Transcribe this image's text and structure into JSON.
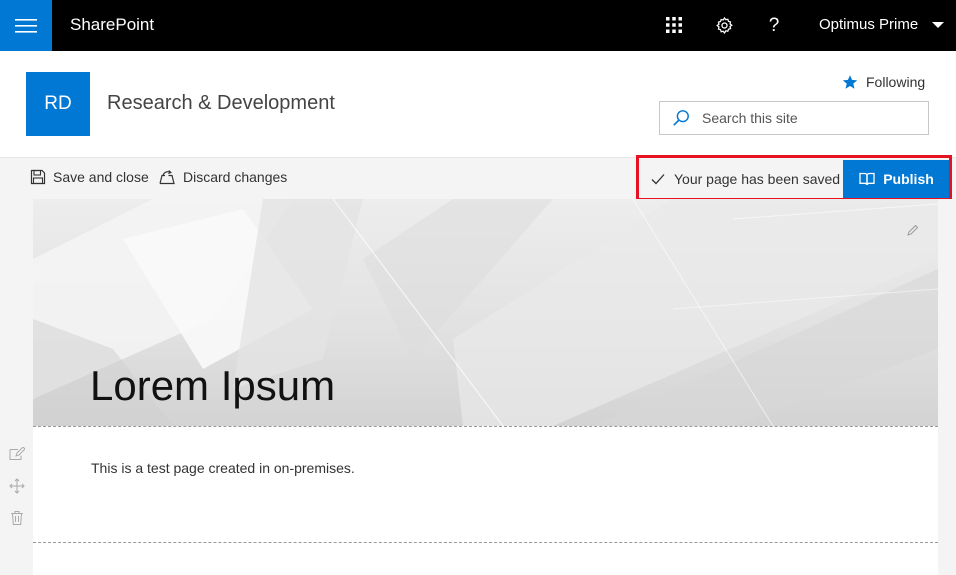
{
  "suitebar": {
    "brand": "SharePoint",
    "user_name": "Optimus Prime",
    "help_glyph": "?",
    "icons": {
      "menu": "hamburger-icon",
      "app_launcher": "app-launcher-icon",
      "settings": "gear-icon",
      "help": "help-icon",
      "user_menu": "chevron-down-icon"
    }
  },
  "site": {
    "logo_initials": "RD",
    "title": "Research & Development",
    "following_label": "Following",
    "search_placeholder": "Search this site"
  },
  "commandbar": {
    "save_close_label": "Save and close",
    "discard_label": "Discard changes",
    "status_text": "Your page has been saved",
    "publish_label": "Publish"
  },
  "page": {
    "title": "Lorem Ipsum",
    "body_text": "This is a test page created in on-premises."
  },
  "colors": {
    "brand_blue": "#0078d4",
    "suitebar_bg": "#000000",
    "highlight_red": "#e81123"
  }
}
